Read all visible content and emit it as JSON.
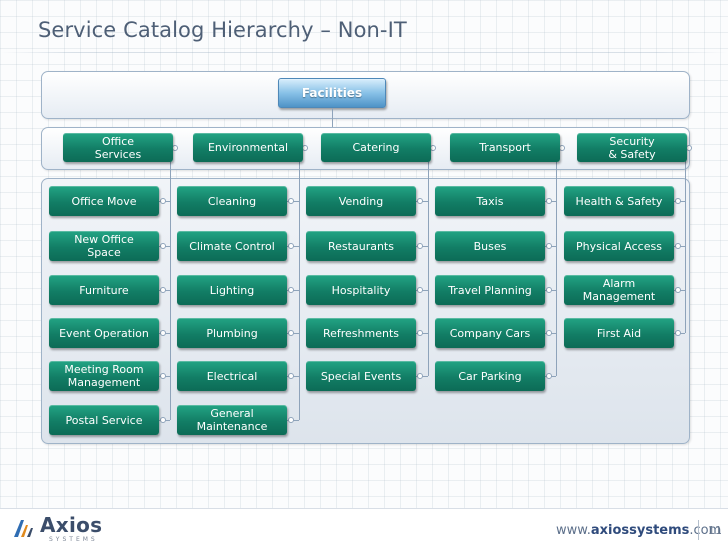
{
  "title": "Service Catalog Hierarchy – Non-IT",
  "root": {
    "label": "Facilities"
  },
  "categories": [
    {
      "label": "Office\nServices",
      "items": [
        "Office Move",
        "New Office\nSpace",
        "Furniture",
        "Event Operation",
        "Meeting Room\nManagement",
        "Postal Service"
      ]
    },
    {
      "label": "Environmental",
      "items": [
        "Cleaning",
        "Climate Control",
        "Lighting",
        "Plumbing",
        "Electrical",
        "General\nMaintenance"
      ]
    },
    {
      "label": "Catering",
      "items": [
        "Vending",
        "Restaurants",
        "Hospitality",
        "Refreshments",
        "Special Events"
      ]
    },
    {
      "label": "Transport",
      "items": [
        "Taxis",
        "Buses",
        "Travel Planning",
        "Company Cars",
        "Car Parking"
      ]
    },
    {
      "label": "Security\n& Safety",
      "items": [
        "Health & Safety",
        "Physical Access",
        "Alarm\nManagement",
        "First Aid"
      ]
    }
  ],
  "footer": {
    "logo_text": "Axios",
    "logo_sub": "SYSTEMS",
    "website_prefix": "www.",
    "website_bold": "axiossystems",
    "website_suffix": ".com",
    "page_number": "11"
  },
  "colors": {
    "box_green": "#127d65",
    "root_blue": "#6aa9d8",
    "connector": "#8ea3ba",
    "title_text": "#4e5f76"
  }
}
